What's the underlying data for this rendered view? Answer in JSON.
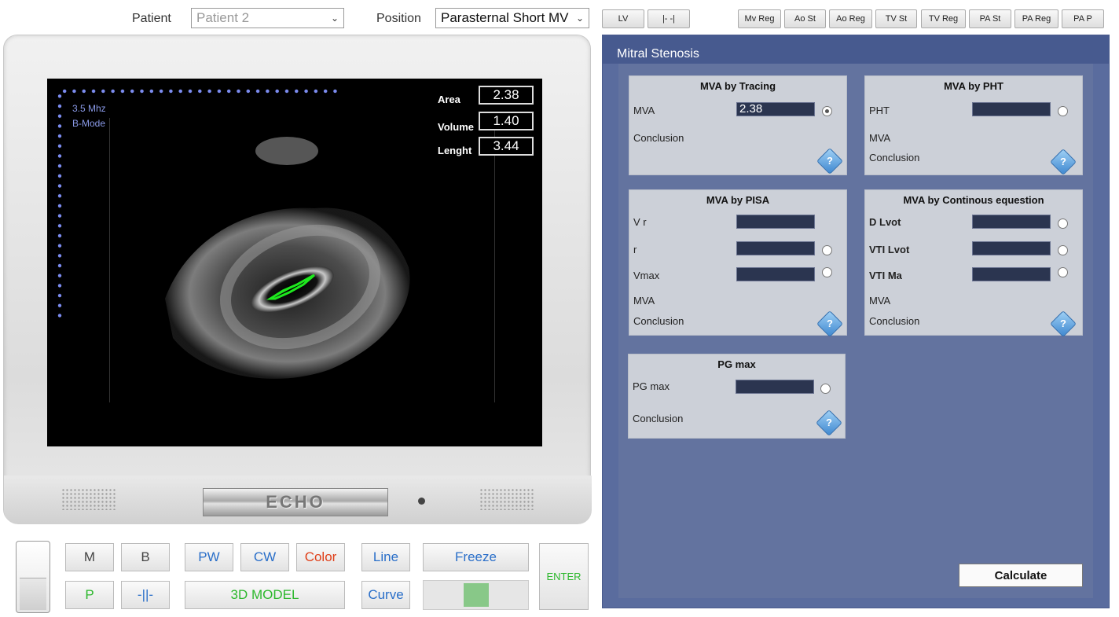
{
  "topbar": {
    "patient_label": "Patient",
    "patient_value": "Patient 2",
    "position_label": "Position",
    "position_value": "Parasternal Short MV",
    "nav_buttons": [
      "LV",
      "|- -|"
    ],
    "view_buttons": [
      "Mv Reg",
      "Ao St",
      "Ao Reg",
      "TV St",
      "TV Reg",
      "PA St",
      "PA Reg",
      "PA P"
    ]
  },
  "screen": {
    "frequency": "3.5 Mhz",
    "mode": "B-Mode",
    "measurements": [
      {
        "label": "Area",
        "value": "2.38"
      },
      {
        "label": "Volume",
        "value": "1.40"
      },
      {
        "label": "Lenght",
        "value": "3.44"
      }
    ],
    "brand": "ECHO"
  },
  "controls": {
    "m": "M",
    "b": "B",
    "p": "P",
    "split": "-||-",
    "pw": "PW",
    "cw": "CW",
    "color": "Color",
    "model3d": "3D MODEL",
    "line": "Line",
    "curve": "Curve",
    "freeze": "Freeze",
    "enter": "ENTER",
    "freeze_slider_level": 0.5
  },
  "panel": {
    "title": "Mitral Stenosis",
    "tracing": {
      "title": "MVA by Tracing",
      "mva_label": "MVA",
      "mva_value": "2.38",
      "conclusion": "Conclusion"
    },
    "pht": {
      "title": "MVA by PHT",
      "pht_label": "PHT",
      "mva_label": "MVA",
      "conclusion": "Conclusion"
    },
    "pisa": {
      "title": "MVA by PISA",
      "vr_label": "V r",
      "r_label": "r",
      "vmax_label": "Vmax",
      "mva_label": "MVA",
      "conclusion": "Conclusion"
    },
    "continuous": {
      "title": "MVA by Continous equestion",
      "dlvot_label": "D Lvot",
      "vtilvot_label": "VTI Lvot",
      "vtima_label": "VTI Ma",
      "mva_label": "MVA",
      "conclusion": "Conclusion"
    },
    "pg": {
      "title": "PG max",
      "pg_label": "PG max",
      "conclusion": "Conclusion"
    },
    "help_symbol": "?",
    "calculate": "Calculate"
  }
}
